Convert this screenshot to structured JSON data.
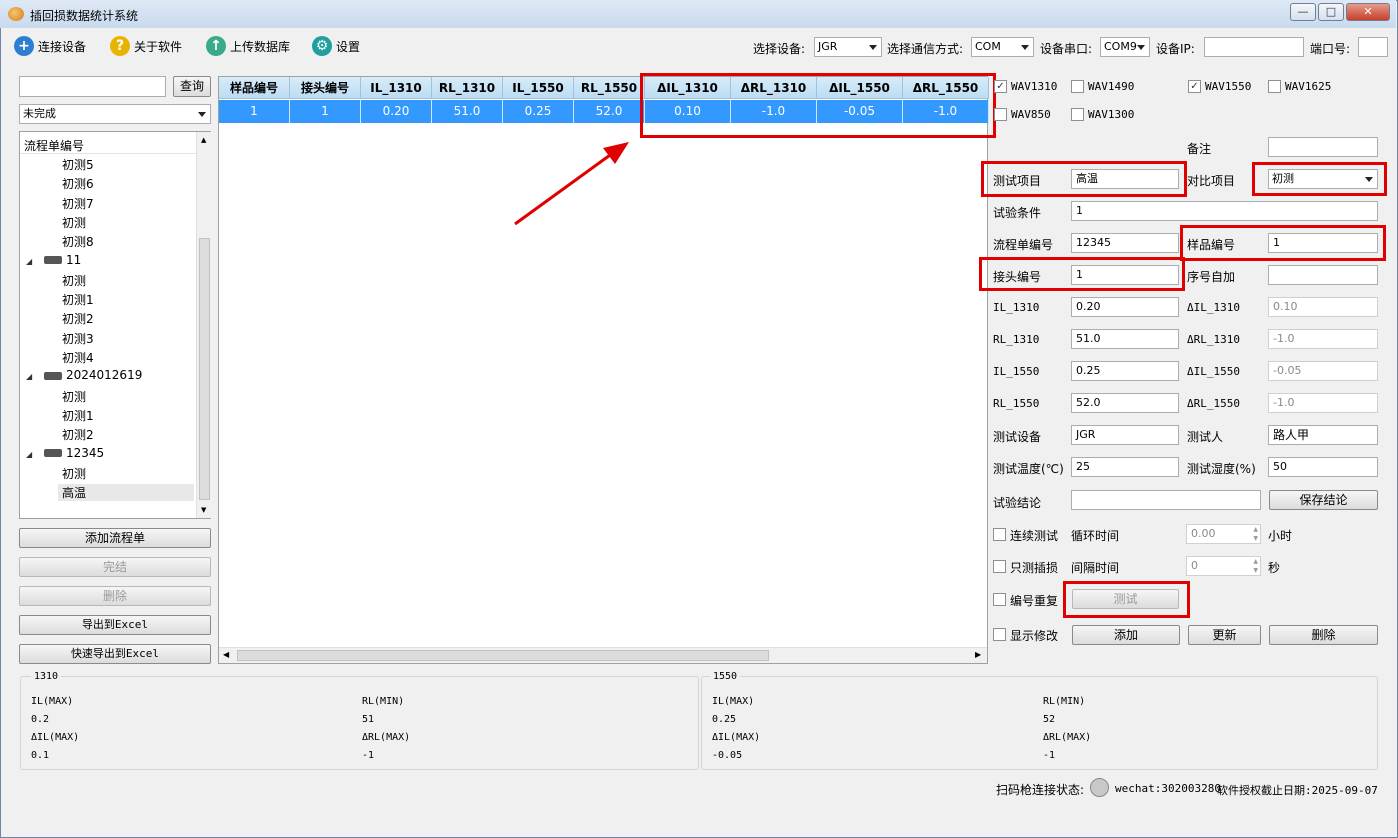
{
  "window": {
    "title": "插回损数据统计系统"
  },
  "toolbar": {
    "connect": "连接设备",
    "about": "关于软件",
    "upload": "上传数据库",
    "settings": "设置",
    "device_label": "选择设备:",
    "device_value": "JGR",
    "comm_label": "选择通信方式:",
    "comm_value": "COM",
    "port_label": "设备串口:",
    "port_value": "COM9",
    "ip_label": "设备IP:",
    "ip_value": "",
    "portnum_label": "端口号:",
    "portnum_value": ""
  },
  "left": {
    "search_value": "",
    "search_button": "查询",
    "status_filter": "未完成",
    "tree_header": "流程单编号",
    "tree": [
      {
        "label": "初测5",
        "level": 2
      },
      {
        "label": "初测6",
        "level": 2
      },
      {
        "label": "初测7",
        "level": 2
      },
      {
        "label": "初测",
        "level": 2
      },
      {
        "label": "初测8",
        "level": 2
      },
      {
        "label": "11",
        "level": 1
      },
      {
        "label": "初测",
        "level": 2
      },
      {
        "label": "初测1",
        "level": 2
      },
      {
        "label": "初测2",
        "level": 2
      },
      {
        "label": "初测3",
        "level": 2
      },
      {
        "label": "初测4",
        "level": 2
      },
      {
        "label": "2024012619",
        "level": 1
      },
      {
        "label": "初测",
        "level": 2
      },
      {
        "label": "初测1",
        "level": 2
      },
      {
        "label": "初测2",
        "level": 2
      },
      {
        "label": "12345",
        "level": 1
      },
      {
        "label": "初测",
        "level": 2
      },
      {
        "label": "高温",
        "level": 2
      }
    ],
    "buttons": {
      "add": "添加流程单",
      "finish": "完结",
      "delete": "删除",
      "export": "导出到Excel",
      "quick_export": "快速导出到Excel"
    }
  },
  "grid": {
    "columns": [
      "样品编号",
      "接头编号",
      "IL_1310",
      "RL_1310",
      "IL_1550",
      "RL_1550",
      "ΔIL_1310",
      "ΔRL_1310",
      "ΔIL_1550",
      "ΔRL_1550"
    ],
    "rows": [
      [
        "1",
        "1",
        "0.20",
        "51.0",
        "0.25",
        "52.0",
        "0.10",
        "-1.0",
        "-0.05",
        "-1.0"
      ]
    ]
  },
  "right": {
    "wavelengths": [
      {
        "label": "WAV1310",
        "checked": true
      },
      {
        "label": "WAV1490",
        "checked": false
      },
      {
        "label": "WAV1550",
        "checked": true
      },
      {
        "label": "WAV1625",
        "checked": false
      },
      {
        "label": "WAV850",
        "checked": false
      },
      {
        "label": "WAV1300",
        "checked": false
      }
    ],
    "remark_label": "备注",
    "remark_value": "",
    "test_item_label": "测试项目",
    "test_item_value": "高温",
    "compare_label": "对比项目",
    "compare_value": "初测",
    "condition_label": "试验条件",
    "condition_value": "1",
    "flow_label": "流程单编号",
    "flow_value": "12345",
    "sample_label": "样品编号",
    "sample_value": "1",
    "connector_label": "接头编号",
    "connector_value": "1",
    "seq_label": "序号自加",
    "seq_value": "",
    "il1310_label": "IL_1310",
    "il1310_value": "0.20",
    "dil1310_label": "ΔIL_1310",
    "dil1310_value": "0.10",
    "rl1310_label": "RL_1310",
    "rl1310_value": "51.0",
    "drl1310_label": "ΔRL_1310",
    "drl1310_value": "-1.0",
    "il1550_label": "IL_1550",
    "il1550_value": "0.25",
    "dil1550_label": "ΔIL_1550",
    "dil1550_value": "-0.05",
    "rl1550_label": "RL_1550",
    "rl1550_value": "52.0",
    "drl1550_label": "ΔRL_1550",
    "drl1550_value": "-1.0",
    "device_label": "测试设备",
    "device_value": "JGR",
    "tester_label": "测试人",
    "tester_value": "路人甲",
    "temp_label": "测试温度(℃)",
    "temp_value": "25",
    "humid_label": "测试湿度(%)",
    "humid_value": "50",
    "conclusion_label": "试验结论",
    "conclusion_value": "",
    "save_conclusion": "保存结论",
    "continuous_label": "连续测试",
    "cycle_label": "循环时间",
    "cycle_value": "0.00",
    "hours": "小时",
    "il_only_label": "只测插损",
    "interval_label": "间隔时间",
    "interval_value": "0",
    "seconds": "秒",
    "dup_label": "编号重复",
    "test_button": "测试",
    "show_modify_label": "显示修改",
    "add_button": "添加",
    "update_button": "更新",
    "delete_button": "删除"
  },
  "stats": {
    "g1310": {
      "title": "1310",
      "il_max_label": "IL(MAX)",
      "il_max": "0.2",
      "rl_min_label": "RL(MIN)",
      "rl_min": "51",
      "dil_max_label": "ΔIL(MAX)",
      "dil_max": "0.1",
      "drl_max_label": "ΔRL(MAX)",
      "drl_max": "-1"
    },
    "g1550": {
      "title": "1550",
      "il_max_label": "IL(MAX)",
      "il_max": "0.25",
      "rl_min_label": "RL(MIN)",
      "rl_min": "52",
      "dil_max_label": "ΔIL(MAX)",
      "dil_max": "-0.05",
      "drl_max_label": "ΔRL(MAX)",
      "drl_max": "-1"
    }
  },
  "statusbar": {
    "scanner_label": "扫码枪连接状态:",
    "wechat": "wechat:302003280",
    "license": "软件授权截止日期:2025-09-07"
  }
}
